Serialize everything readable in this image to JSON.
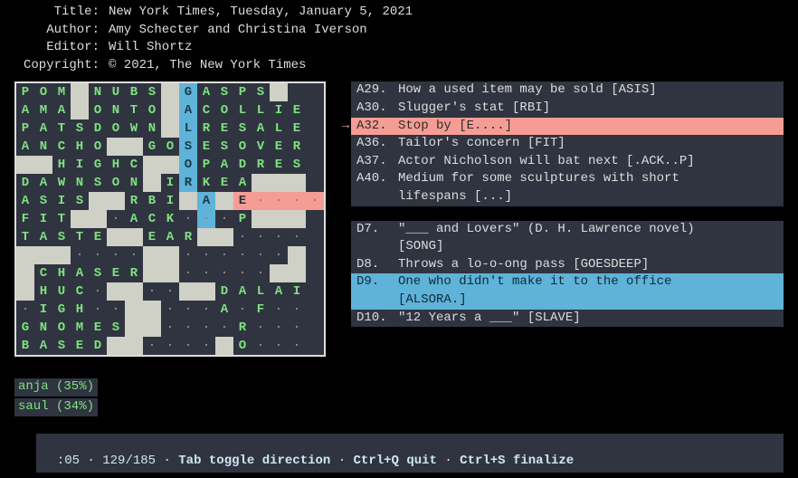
{
  "meta": {
    "title_label": "Title:",
    "author_label": "Author:",
    "editor_label": "Editor:",
    "copyright_label": "Copyright:",
    "title": "New York Times, Tuesday, January 5, 2021",
    "author": "Amy Schecter and Christina Iverson",
    "editor": "Will Shortz",
    "copyright": "© 2021, The New York Times"
  },
  "grid_rows": [
    [
      [
        "P",
        "f"
      ],
      [
        "O",
        "f"
      ],
      [
        "M",
        "f"
      ],
      [
        "",
        "b"
      ],
      [
        "N",
        "f"
      ],
      [
        "U",
        "f"
      ],
      [
        "B",
        "f"
      ],
      [
        "S",
        "f"
      ],
      [
        "",
        "b"
      ],
      [
        "G",
        "c"
      ],
      [
        "A",
        "f"
      ],
      [
        "S",
        "f"
      ],
      [
        "P",
        "f"
      ],
      [
        "S",
        "f"
      ],
      [
        "",
        "b"
      ]
    ],
    [
      [
        "A",
        "f"
      ],
      [
        "M",
        "f"
      ],
      [
        "A",
        "f"
      ],
      [
        "",
        "b"
      ],
      [
        "O",
        "f"
      ],
      [
        "N",
        "f"
      ],
      [
        "T",
        "f"
      ],
      [
        "O",
        "f"
      ],
      [
        "",
        "b"
      ],
      [
        "A",
        "c"
      ],
      [
        "C",
        "f"
      ],
      [
        "O",
        "f"
      ],
      [
        "L",
        "f"
      ],
      [
        "L",
        "f"
      ],
      [
        "I",
        "f"
      ],
      [
        "E",
        "f"
      ]
    ],
    [
      [
        "P",
        "f"
      ],
      [
        "A",
        "f"
      ],
      [
        "T",
        "f"
      ],
      [
        "S",
        "f"
      ],
      [
        "D",
        "f"
      ],
      [
        "O",
        "f"
      ],
      [
        "W",
        "f"
      ],
      [
        "N",
        "f"
      ],
      [
        "",
        "b"
      ],
      [
        "L",
        "c"
      ],
      [
        "R",
        "f"
      ],
      [
        "E",
        "f"
      ],
      [
        "S",
        "f"
      ],
      [
        "A",
        "f"
      ],
      [
        "L",
        "f"
      ],
      [
        "E",
        "f"
      ]
    ],
    [
      [
        "A",
        "f"
      ],
      [
        "N",
        "f"
      ],
      [
        "C",
        "f"
      ],
      [
        "H",
        "f"
      ],
      [
        "O",
        "f"
      ],
      [
        "",
        "b"
      ],
      [
        "",
        "b"
      ],
      [
        "G",
        "f"
      ],
      [
        "O",
        "f"
      ],
      [
        "S",
        "c"
      ],
      [
        "E",
        "f"
      ],
      [
        "S",
        "f"
      ],
      [
        "O",
        "f"
      ],
      [
        "V",
        "f"
      ],
      [
        "E",
        "f"
      ],
      [
        "R",
        "f"
      ]
    ],
    [
      [
        "",
        "b"
      ],
      [
        "",
        "b"
      ],
      [
        "H",
        "f"
      ],
      [
        "I",
        "f"
      ],
      [
        "G",
        "f"
      ],
      [
        "H",
        "f"
      ],
      [
        "C",
        "f"
      ],
      [
        "",
        "b"
      ],
      [
        "",
        "b"
      ],
      [
        "O",
        "c"
      ],
      [
        "P",
        "f"
      ],
      [
        "A",
        "f"
      ],
      [
        "D",
        "f"
      ],
      [
        "R",
        "f"
      ],
      [
        "E",
        "f"
      ],
      [
        "S",
        "f"
      ]
    ],
    [
      [
        "D",
        "f"
      ],
      [
        "A",
        "f"
      ],
      [
        "W",
        "f"
      ],
      [
        "N",
        "f"
      ],
      [
        "S",
        "f"
      ],
      [
        "O",
        "f"
      ],
      [
        "N",
        "f"
      ],
      [
        "",
        "b"
      ],
      [
        "I",
        "f"
      ],
      [
        "R",
        "c"
      ],
      [
        "K",
        "f"
      ],
      [
        "E",
        "f"
      ],
      [
        "A",
        "f"
      ],
      [
        "",
        "b"
      ],
      [
        "",
        "b"
      ],
      [
        "",
        "b"
      ]
    ],
    [
      [
        "A",
        "f"
      ],
      [
        "S",
        "f"
      ],
      [
        "I",
        "f"
      ],
      [
        "S",
        "f"
      ],
      [
        "",
        "b"
      ],
      [
        "",
        "b"
      ],
      [
        "R",
        "f"
      ],
      [
        "B",
        "f"
      ],
      [
        "I",
        "f"
      ],
      [
        "",
        "b"
      ],
      [
        "A",
        "c"
      ],
      [
        "",
        "b"
      ],
      [
        "E",
        "cur"
      ],
      [
        ".",
        "r"
      ],
      [
        ".",
        "r"
      ],
      [
        ".",
        "r"
      ],
      [
        ".",
        "r"
      ]
    ],
    [
      [
        "F",
        "f"
      ],
      [
        "I",
        "f"
      ],
      [
        "T",
        "f"
      ],
      [
        "",
        "b"
      ],
      [
        "",
        "b"
      ],
      [
        ".",
        "e"
      ],
      [
        "A",
        "f"
      ],
      [
        "C",
        "f"
      ],
      [
        "K",
        "f"
      ],
      [
        ".",
        "e"
      ],
      [
        ".",
        "c"
      ],
      [
        ".",
        "e"
      ],
      [
        "P",
        "f"
      ],
      [
        "",
        "b"
      ],
      [
        "",
        "b"
      ],
      [
        "",
        "b"
      ]
    ],
    [
      [
        "T",
        "f"
      ],
      [
        "A",
        "f"
      ],
      [
        "S",
        "f"
      ],
      [
        "T",
        "f"
      ],
      [
        "E",
        "f"
      ],
      [
        "",
        "b"
      ],
      [
        "",
        "b"
      ],
      [
        "E",
        "f"
      ],
      [
        "A",
        "f"
      ],
      [
        "R",
        "f"
      ],
      [
        "",
        "b"
      ],
      [
        "",
        "b"
      ],
      [
        ".",
        "e"
      ],
      [
        ".",
        "e"
      ],
      [
        ".",
        "e"
      ],
      [
        ".",
        "e"
      ]
    ],
    [
      [
        "",
        "b"
      ],
      [
        "",
        "b"
      ],
      [
        "",
        "b"
      ],
      [
        ".",
        "e"
      ],
      [
        ".",
        "e"
      ],
      [
        ".",
        "e"
      ],
      [
        ".",
        "e"
      ],
      [
        "",
        "b"
      ],
      [
        "",
        "b"
      ],
      [
        ".",
        "e"
      ],
      [
        ".",
        "e"
      ],
      [
        ".",
        "e"
      ],
      [
        ".",
        "e"
      ],
      [
        ".",
        "e"
      ],
      [
        ".",
        "e"
      ],
      [
        "",
        "b"
      ]
    ],
    [
      [
        "",
        "b"
      ],
      [
        "C",
        "f"
      ],
      [
        "H",
        "f"
      ],
      [
        "A",
        "f"
      ],
      [
        "S",
        "f"
      ],
      [
        "E",
        "f"
      ],
      [
        "R",
        "f"
      ],
      [
        "",
        "b"
      ],
      [
        "",
        "b"
      ],
      [
        ".",
        "e"
      ],
      [
        ".",
        "e"
      ],
      [
        ".",
        "e"
      ],
      [
        ".",
        "e"
      ],
      [
        ".",
        "e"
      ],
      [
        "",
        "b"
      ],
      [
        "",
        "b"
      ]
    ],
    [
      [
        "",
        "b"
      ],
      [
        "H",
        "f"
      ],
      [
        "U",
        "f"
      ],
      [
        "C",
        "f"
      ],
      [
        ".",
        "e"
      ],
      [
        "",
        "b"
      ],
      [
        "",
        "b"
      ],
      [
        ".",
        "e"
      ],
      [
        ".",
        "e"
      ],
      [
        "",
        "b"
      ],
      [
        "",
        "b"
      ],
      [
        "D",
        "f"
      ],
      [
        "A",
        "f"
      ],
      [
        "L",
        "f"
      ],
      [
        "A",
        "f"
      ],
      [
        "I",
        "f"
      ]
    ],
    [
      [
        ".",
        "e"
      ],
      [
        "I",
        "f"
      ],
      [
        "G",
        "f"
      ],
      [
        "H",
        "f"
      ],
      [
        ".",
        "e"
      ],
      [
        ".",
        "e"
      ],
      [
        "",
        "b"
      ],
      [
        "",
        "b"
      ],
      [
        ".",
        "e"
      ],
      [
        ".",
        "e"
      ],
      [
        ".",
        "e"
      ],
      [
        "A",
        "f"
      ],
      [
        ".",
        "e"
      ],
      [
        "F",
        "f"
      ],
      [
        ".",
        "e"
      ],
      [
        ".",
        "e"
      ]
    ],
    [
      [
        "G",
        "f"
      ],
      [
        "N",
        "f"
      ],
      [
        "O",
        "f"
      ],
      [
        "M",
        "f"
      ],
      [
        "E",
        "f"
      ],
      [
        "S",
        "f"
      ],
      [
        "",
        "b"
      ],
      [
        "",
        "b"
      ],
      [
        ".",
        "e"
      ],
      [
        ".",
        "e"
      ],
      [
        ".",
        "e"
      ],
      [
        ".",
        "e"
      ],
      [
        "R",
        "f"
      ],
      [
        ".",
        "e"
      ],
      [
        ".",
        "e"
      ],
      [
        ".",
        "e"
      ]
    ],
    [
      [
        "B",
        "f"
      ],
      [
        "A",
        "f"
      ],
      [
        "S",
        "f"
      ],
      [
        "E",
        "f"
      ],
      [
        "D",
        "f"
      ],
      [
        "",
        "b"
      ],
      [
        "",
        "b"
      ],
      [
        ".",
        "e"
      ],
      [
        ".",
        "e"
      ],
      [
        ".",
        "e"
      ],
      [
        ".",
        "e"
      ],
      [
        "",
        "b"
      ],
      [
        "O",
        "f"
      ],
      [
        ".",
        "e"
      ],
      [
        ".",
        "e"
      ],
      [
        ".",
        "e"
      ]
    ]
  ],
  "suggest": {
    "items": [
      "anja (35%)",
      "saul (34%)"
    ]
  },
  "clues": {
    "across": [
      {
        "num": "A29.",
        "text": "How a used item may be sold [ASIS]",
        "hl": false
      },
      {
        "num": "A30.",
        "text": "Slugger's stat [RBI]",
        "hl": false
      },
      {
        "num": "A32.",
        "text": "Stop by [E....]",
        "hl": true,
        "arrow": true
      },
      {
        "num": "A36.",
        "text": "Tailor's concern [FIT]",
        "hl": false
      },
      {
        "num": "A37.",
        "text": "Actor Nicholson will bat next [.ACK..P]",
        "hl": false
      },
      {
        "num": "A40.",
        "text": "Medium for some sculptures with short",
        "cont": "lifespans [...]",
        "hl": false
      }
    ],
    "down": [
      {
        "num": "D7.",
        "text": "\"___ and Lovers\" (D. H. Lawrence novel)",
        "cont": "[SONG]",
        "hl": false
      },
      {
        "num": "D8.",
        "text": "Throws a lo-o-ong pass [GOESDEEP]",
        "hl": false
      },
      {
        "num": "D9.",
        "text": "One who didn't make it to the office",
        "cont": "[ALSORA.]",
        "hl": true
      },
      {
        "num": "D10.",
        "text": "\"12 Years a ___\" [SLAVE]",
        "hl": false
      }
    ]
  },
  "status": {
    "time": ":05",
    "progress": "129/185",
    "hint1": "Tab toggle direction",
    "hint2": "Ctrl+Q quit",
    "hint3": "Ctrl+S finalize"
  }
}
